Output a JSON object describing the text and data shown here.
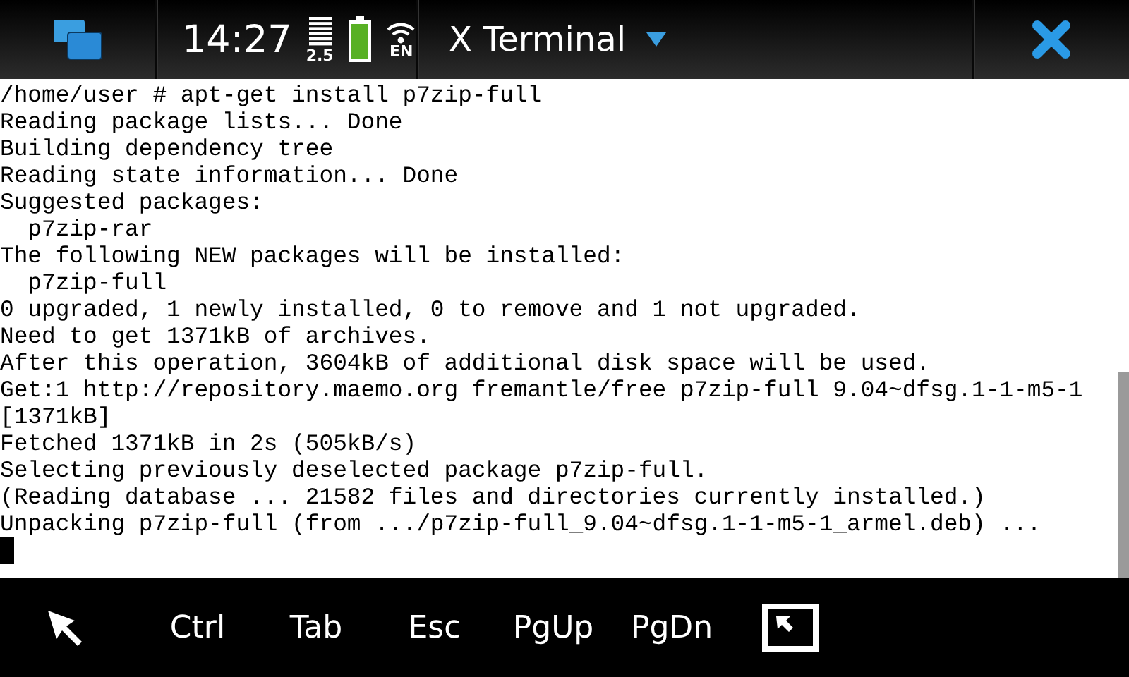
{
  "status_bar": {
    "time": "14:27",
    "network_label": "2.5",
    "input_language": "EN",
    "title": "X Terminal"
  },
  "terminal": {
    "lines": [
      "/home/user # apt-get install p7zip-full",
      "Reading package lists... Done",
      "Building dependency tree",
      "Reading state information... Done",
      "Suggested packages:",
      "  p7zip-rar",
      "The following NEW packages will be installed:",
      "  p7zip-full",
      "0 upgraded, 1 newly installed, 0 to remove and 1 not upgraded.",
      "Need to get 1371kB of archives.",
      "After this operation, 3604kB of additional disk space will be used.",
      "Get:1 http://repository.maemo.org fremantle/free p7zip-full 9.04~dfsg.1-1-m5-1",
      "[1371kB]",
      "Fetched 1371kB in 2s (505kB/s)",
      "Selecting previously deselected package p7zip-full.",
      "(Reading database ... 21582 files and directories currently installed.)",
      "Unpacking p7zip-full (from .../p7zip-full_9.04~dfsg.1-1-m5-1_armel.deb) ..."
    ]
  },
  "toolbar": {
    "keys": [
      {
        "kind": "pointer"
      },
      {
        "kind": "key",
        "label": "Ctrl"
      },
      {
        "kind": "key",
        "label": "Tab"
      },
      {
        "kind": "key",
        "label": "Esc"
      },
      {
        "kind": "key",
        "label": "PgUp"
      },
      {
        "kind": "key",
        "label": "PgDn"
      },
      {
        "kind": "fullscreen"
      }
    ]
  }
}
